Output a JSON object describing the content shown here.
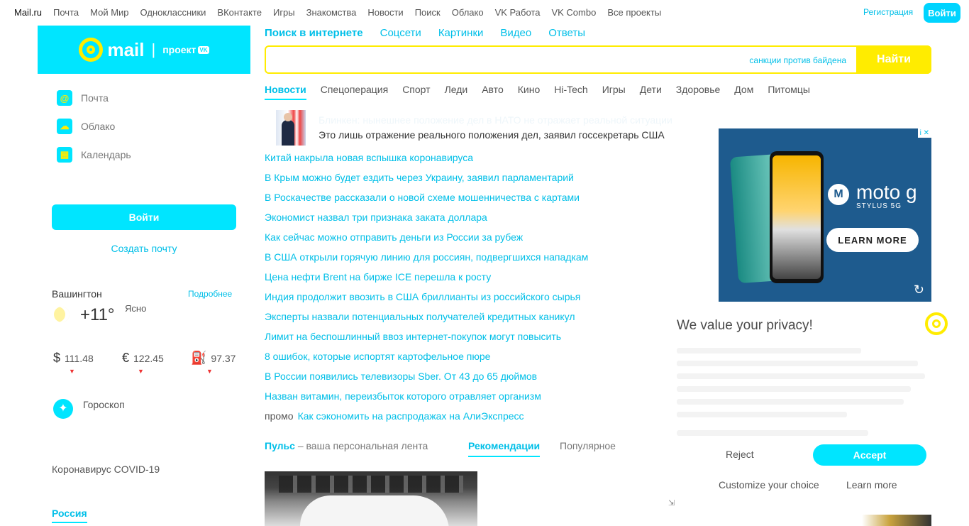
{
  "topnav": {
    "items": [
      "Mail.ru",
      "Почта",
      "Мой Мир",
      "Одноклассники",
      "ВКонтакте",
      "Игры",
      "Знакомства",
      "Новости",
      "Поиск",
      "Облако",
      "VK Работа",
      "VK Combo",
      "Все проекты"
    ],
    "register": "Регистрация",
    "login": "Войти"
  },
  "brand": {
    "word": "mail",
    "sep": "|",
    "project": "проект",
    "vk": "VK"
  },
  "services": [
    {
      "label": "Почта",
      "icon": "@"
    },
    {
      "label": "Облако",
      "icon": "☁"
    },
    {
      "label": "Календарь",
      "icon": "▦"
    }
  ],
  "auth": {
    "login": "Войти",
    "create": "Создать почту"
  },
  "weather": {
    "city": "Вашингтон",
    "more": "Подробнее",
    "temp": "+11°",
    "cond": "Ясно"
  },
  "rates": [
    {
      "sym": "$",
      "value": "111.48",
      "change": "▼"
    },
    {
      "sym": "€",
      "value": "122.45",
      "change": "▼"
    },
    {
      "sym": "⛽",
      "value": "97.37",
      "change": "▼"
    }
  ],
  "horoscope": {
    "label": "Гороскоп",
    "icon": "✦"
  },
  "covid": "Коронавирус COVID-19",
  "region": "Россия",
  "search": {
    "tabs": [
      "Поиск в интернете",
      "Соцсети",
      "Картинки",
      "Видео",
      "Ответы"
    ],
    "hint": "санкции против байдена",
    "button": "Найти"
  },
  "news_tabs": [
    "Новости",
    "Спецоперация",
    "Спорт",
    "Леди",
    "Авто",
    "Кино",
    "Hi-Tech",
    "Игры",
    "Дети",
    "Здоровье",
    "Дом",
    "Питомцы"
  ],
  "top_news": {
    "title": "Блинкен: нынешнее положение дел в НАТО не отражает реальной ситуации",
    "subtitle": "Это лишь отражение реального положения дел, заявил госсекретарь США"
  },
  "news": [
    "Китай накрыла новая вспышка коронавируса",
    "В Крым можно будет ездить через Украину, заявил парламентарий",
    "В Роскачестве рассказали о новой схеме мошенничества с картами",
    "Экономист назвал три признака заката доллара",
    "Как сейчас можно отправить деньги из России за рубеж",
    "В США открыли горячую линию для россиян, подвергшихся нападкам",
    "Цена нефти Brent на бирже ICE перешла к росту",
    "Индия продолжит ввозить в США бриллианты из российского сырья",
    "Эксперты назвали потенциальных получателей кредитных каникул",
    "Лимит на беспошлинный ввоз интернет-покупок могут повысить",
    "8 ошибок, которые испортят картофельное пюре",
    "В России появились телевизоры Sber. От 43 до 65 дюймов",
    "Назван витамин, переизбыток которого отравляет организм"
  ],
  "promo": {
    "tag": "промо",
    "text": "Как сэкономить на распродажах на АлиЭкспресс"
  },
  "feed": {
    "pulse_bold": "Пульс",
    "pulse_rest": " – ваша персональная лента",
    "tab_rec": "Рекомендации",
    "tab_pop": "Популярное"
  },
  "ad": {
    "brand": "moto g",
    "model": "STYLUS 5G",
    "cta": "LEARN MORE",
    "chip": "i ✕",
    "replay": "↻",
    "logo": "M"
  },
  "privacy": {
    "title": "We value your privacy!",
    "reject": "Reject",
    "accept": "Accept",
    "customize": "Customize your choice",
    "learn": "Learn more",
    "small": "⇲"
  }
}
